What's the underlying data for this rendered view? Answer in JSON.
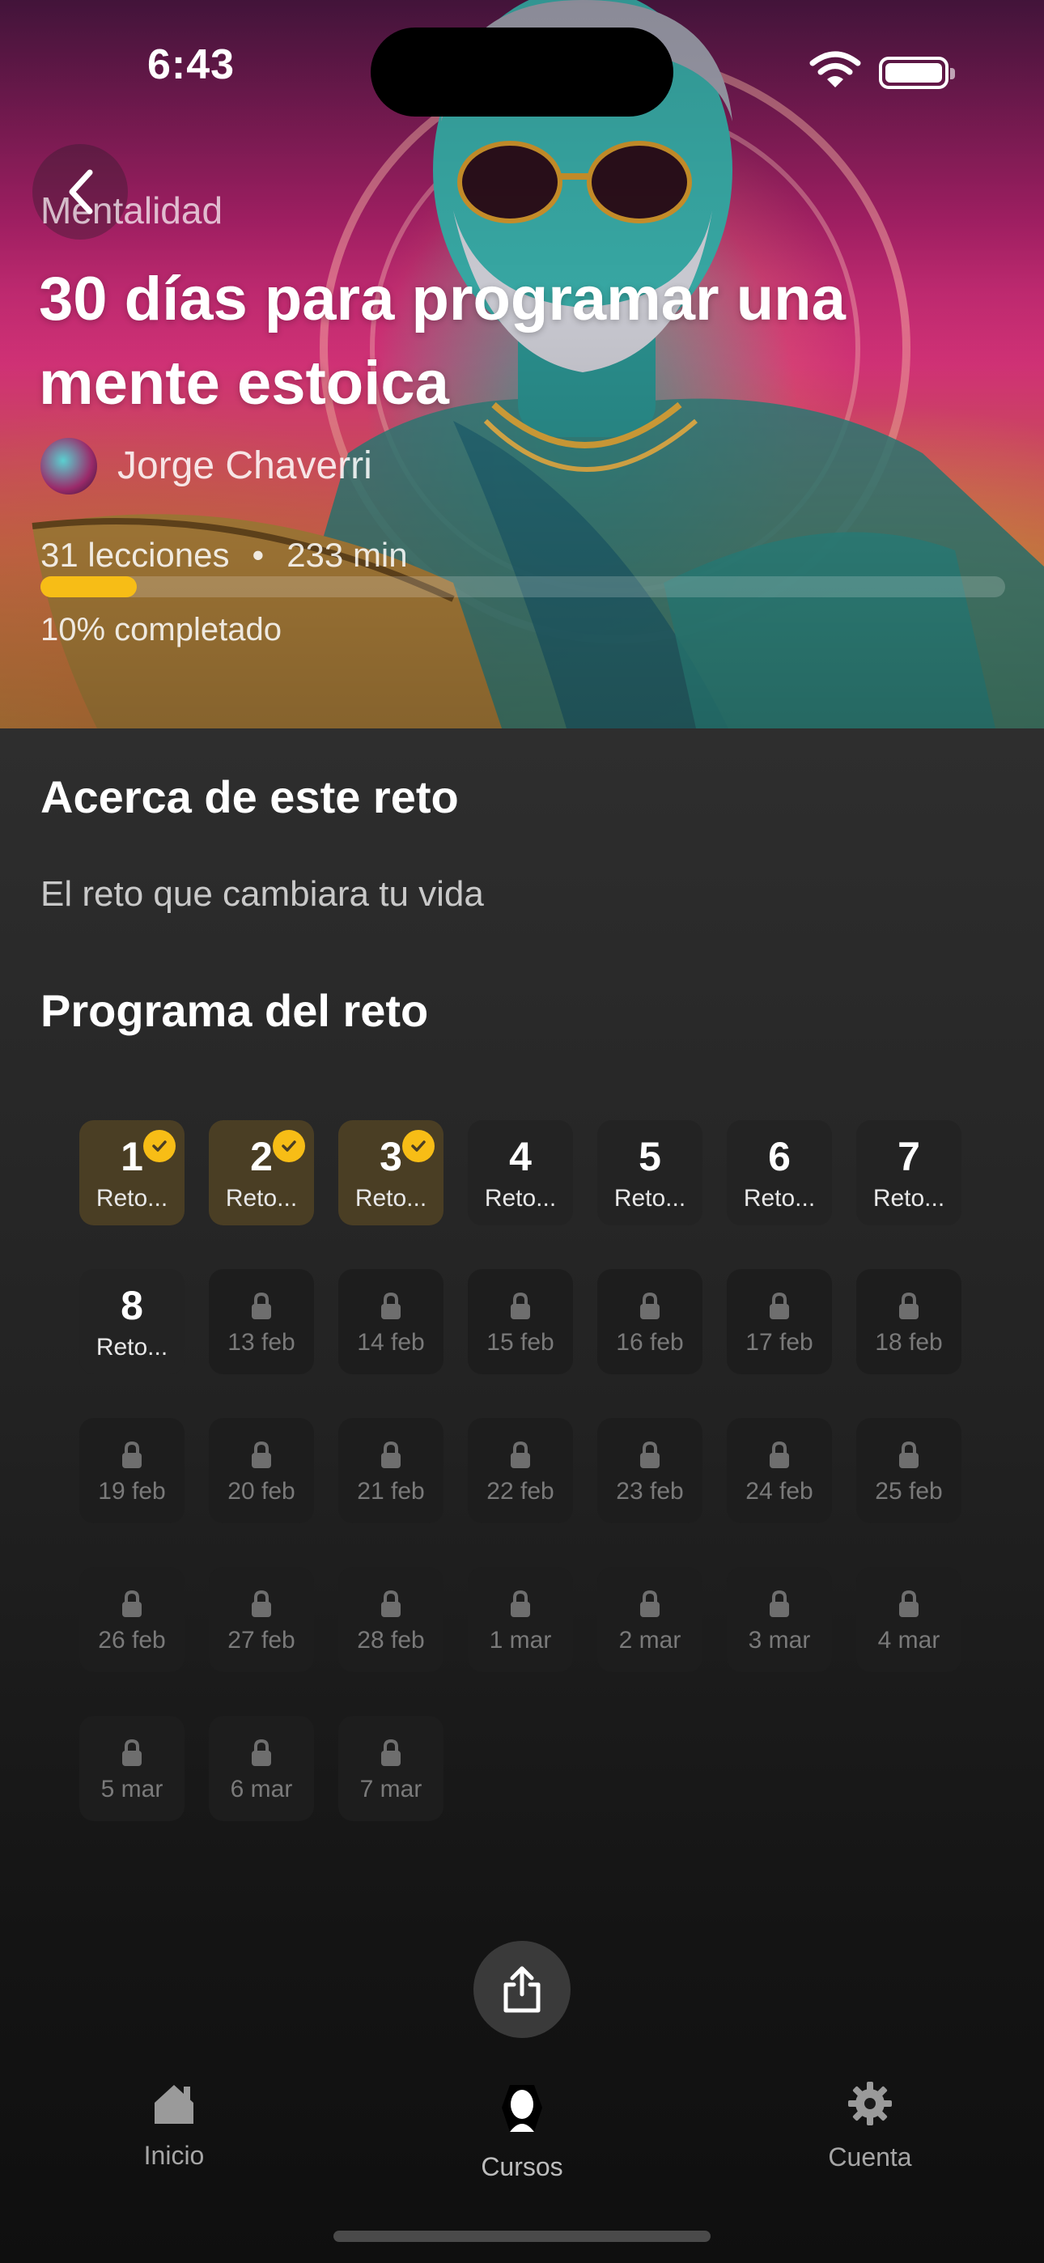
{
  "status_bar": {
    "time": "6:43"
  },
  "hero": {
    "category": "Mentalidad",
    "title": "30 días para programar una mente estoica",
    "author": "Jorge Chaverri",
    "lessons": "31 lecciones",
    "separator": "•",
    "duration": "233 min",
    "progress_fraction": 0.1,
    "progress_label": "10% completado"
  },
  "about": {
    "title": "Acerca de este reto",
    "text": "El reto que cambiara tu vida"
  },
  "program": {
    "title": "Programa del reto",
    "days": [
      {
        "num": "1",
        "sub": "Reto...",
        "state": "done"
      },
      {
        "num": "2",
        "sub": "Reto...",
        "state": "done"
      },
      {
        "num": "3",
        "sub": "Reto...",
        "state": "done"
      },
      {
        "num": "4",
        "sub": "Reto...",
        "state": "open"
      },
      {
        "num": "5",
        "sub": "Reto...",
        "state": "open"
      },
      {
        "num": "6",
        "sub": "Reto...",
        "state": "open"
      },
      {
        "num": "7",
        "sub": "Reto...",
        "state": "open"
      },
      {
        "num": "8",
        "sub": "Reto...",
        "state": "open"
      },
      {
        "date": "13 feb",
        "state": "locked"
      },
      {
        "date": "14 feb",
        "state": "locked"
      },
      {
        "date": "15 feb",
        "state": "locked"
      },
      {
        "date": "16 feb",
        "state": "locked"
      },
      {
        "date": "17 feb",
        "state": "locked"
      },
      {
        "date": "18 feb",
        "state": "locked"
      },
      {
        "date": "19 feb",
        "state": "locked"
      },
      {
        "date": "20 feb",
        "state": "locked"
      },
      {
        "date": "21 feb",
        "state": "locked"
      },
      {
        "date": "22 feb",
        "state": "locked"
      },
      {
        "date": "23 feb",
        "state": "locked"
      },
      {
        "date": "24 feb",
        "state": "locked"
      },
      {
        "date": "25 feb",
        "state": "locked"
      },
      {
        "date": "26 feb",
        "state": "locked"
      },
      {
        "date": "27 feb",
        "state": "locked"
      },
      {
        "date": "28 feb",
        "state": "locked"
      },
      {
        "date": "1 mar",
        "state": "locked"
      },
      {
        "date": "2 mar",
        "state": "locked"
      },
      {
        "date": "3 mar",
        "state": "locked"
      },
      {
        "date": "4 mar",
        "state": "locked"
      },
      {
        "date": "5 mar",
        "state": "locked"
      },
      {
        "date": "6 mar",
        "state": "locked"
      },
      {
        "date": "7 mar",
        "state": "locked"
      }
    ]
  },
  "share": {
    "icon": "share-icon"
  },
  "tabbar": {
    "items": [
      {
        "label": "Inicio",
        "icon": "home-icon",
        "active": false
      },
      {
        "label": "Cursos",
        "icon": "stoic-head-icon",
        "active": true
      },
      {
        "label": "Cuenta",
        "icon": "gear-icon",
        "active": false
      }
    ]
  },
  "colors": {
    "accent": "#f7bd16",
    "background": "#1b1b1b",
    "done_tile": "#4a3e24"
  }
}
